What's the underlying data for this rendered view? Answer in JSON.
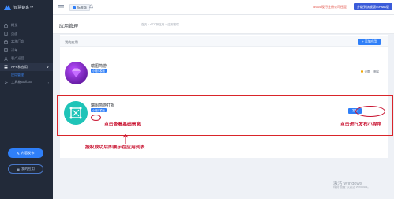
{
  "brand": {
    "name": "智慧链客™"
  },
  "sidebar": {
    "items": [
      {
        "label": "概览",
        "icon": "home-icon"
      },
      {
        "label": "页面",
        "icon": "page-icon"
      },
      {
        "label": "本地门店",
        "icon": "store-icon"
      },
      {
        "label": "订单",
        "icon": "order-icon"
      },
      {
        "label": "客户运营",
        "icon": "user-icon"
      },
      {
        "label": "APP和应用",
        "icon": "app-icon",
        "active": true,
        "caret": "∨"
      },
      {
        "label": "应用管理",
        "sub": true
      },
      {
        "label": "工具箱toolbox",
        "icon": "tool-icon",
        "caret": "›"
      }
    ],
    "primary_button": "内容发布",
    "secondary_button": "我的应用"
  },
  "topbar": {
    "badge": "标准版",
    "warning": "5954,现行注册公司还是",
    "upgrade": "升级到旗舰版/SPaas版"
  },
  "page": {
    "title": "应用管理",
    "breadcrumb": "首页  >  APP和应用  >  应用管理"
  },
  "panel": {
    "title": "我的应用",
    "add_button": "+ 添加应用"
  },
  "apps": [
    {
      "name": "瑞图简游",
      "tag": "小程序模板",
      "actions": [
        "设置",
        "删除"
      ]
    },
    {
      "name": "瑞图简游打折",
      "tag": "小程序模板",
      "publish": "发布"
    }
  ],
  "annotations": {
    "view_info": "点击查看基础信息",
    "publish_hint": "点击进行发布小程序",
    "auth_hint": "授权成功后即展示在应用列表"
  },
  "watermark": {
    "line1": "激活 Windows",
    "line2": "转到\"设置\"以激活 Windows。"
  },
  "colors": {
    "sidebar_bg": "#222a39",
    "accent": "#2f7ff8",
    "annotation": "#c8102e"
  }
}
